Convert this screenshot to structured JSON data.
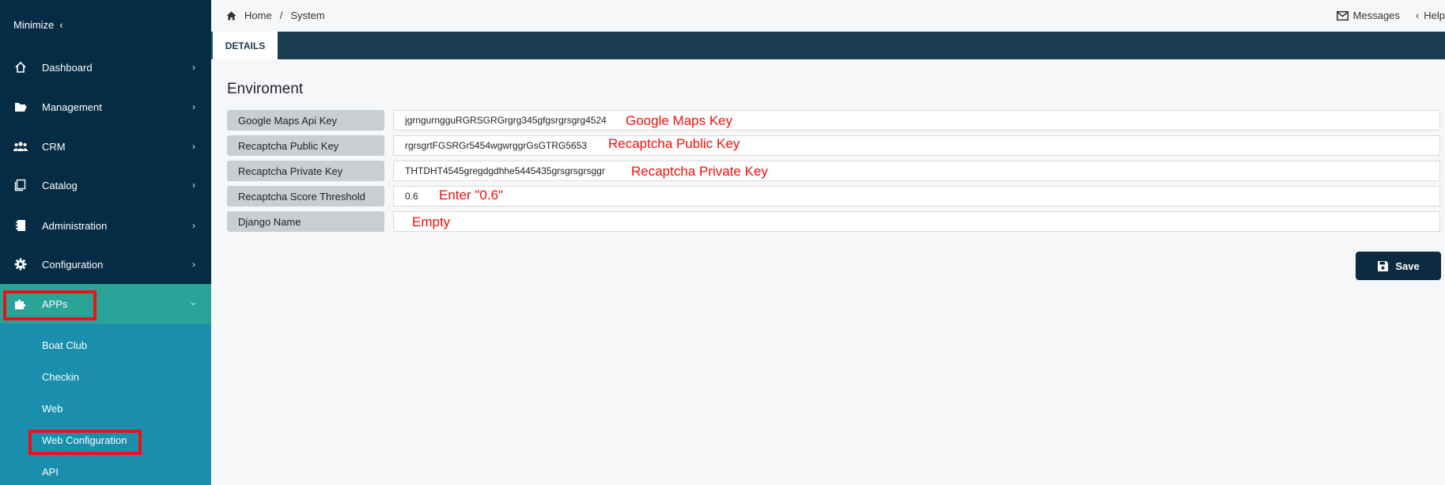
{
  "sidebar": {
    "minimize_label": "Minimize",
    "items": [
      {
        "label": "Dashboard",
        "icon": "home-icon"
      },
      {
        "label": "Management",
        "icon": "folder-open-icon"
      },
      {
        "label": "CRM",
        "icon": "users-icon"
      },
      {
        "label": "Catalog",
        "icon": "catalog-icon"
      },
      {
        "label": "Administration",
        "icon": "notebook-icon"
      },
      {
        "label": "Configuration",
        "icon": "gear-icon"
      },
      {
        "label": "APPs",
        "icon": "puzzle-icon",
        "active": true
      }
    ],
    "submenu": [
      "Boat Club",
      "Checkin",
      "Web",
      "Web Configuration",
      "API"
    ],
    "colors": {
      "bg": "#062c45",
      "active": "#2aa398",
      "submenu": "#1a8fad"
    }
  },
  "topbar": {
    "breadcrumb": [
      "Home",
      "System"
    ],
    "separator": "/",
    "messages_label": "Messages",
    "help_label": "Help"
  },
  "tabs": [
    {
      "label": "DETAILS",
      "active": true
    }
  ],
  "main": {
    "section_title": "Enviroment",
    "fields": [
      {
        "label": "Google Maps Api Key",
        "value": "jgrngurngguRGRSGRGrgrg345gfgsrgrsgrg4524",
        "annotation": "Google Maps Key"
      },
      {
        "label": "Recaptcha Public Key",
        "value": "rgrsgrtFGSRGr5454wgwrggrGsGTRG5653",
        "annotation": "Recaptcha Public Key"
      },
      {
        "label": "Recaptcha Private Key",
        "value": "THTDHT4545gregdgdhhe5445435grsgrsgrsggr",
        "annotation": "Recaptcha Private Key"
      },
      {
        "label": "Recaptcha Score Threshold",
        "value": "0.6",
        "annotation": "Enter \"0.6\""
      },
      {
        "label": "Django Name",
        "value": "",
        "annotation": "Empty"
      }
    ],
    "save_label": "Save"
  },
  "annotation_color": "#e11111"
}
